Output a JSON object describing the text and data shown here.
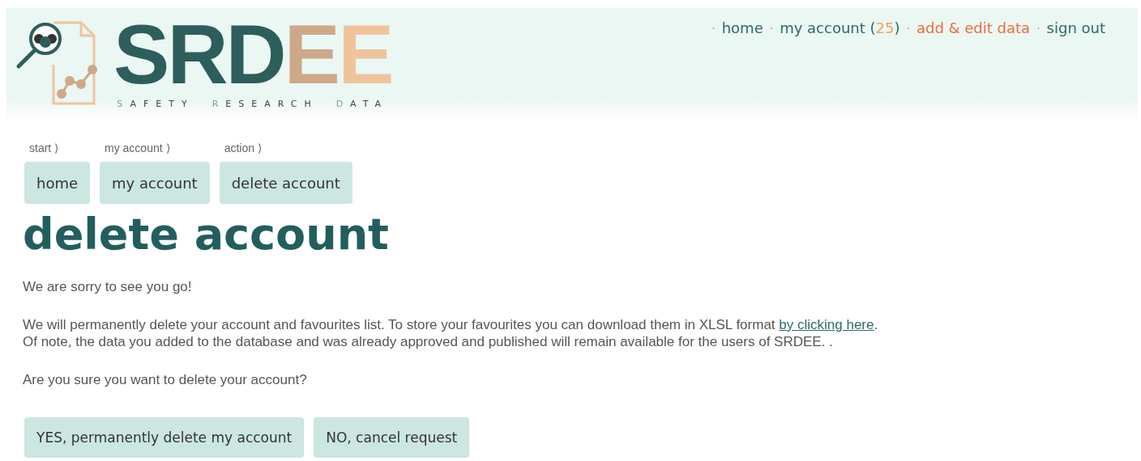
{
  "logo": {
    "letters": [
      {
        "text": "S",
        "color": "#2e5e5c"
      },
      {
        "text": "R",
        "color": "#2e5e5c"
      },
      {
        "text": "D",
        "color": "#2e5e5c"
      },
      {
        "text": "E",
        "color": "#cfa889"
      },
      {
        "text": "E",
        "color": "#efc49d"
      }
    ],
    "tagline": [
      "SAFETY",
      "RESEARCH",
      "DATA"
    ]
  },
  "nav": [
    {
      "separator": "·",
      "label": "home",
      "highlighted": false
    },
    {
      "separator": "·",
      "label": "my account (",
      "count": "25",
      "suffix": ")",
      "highlighted": false
    },
    {
      "separator": "·",
      "label": "add & edit data",
      "highlighted": true
    },
    {
      "separator": "·",
      "label": "sign out",
      "highlighted": false
    }
  ],
  "breadcrumb": [
    {
      "step": "start ⟩",
      "label": "home"
    },
    {
      "step": "my account ⟩",
      "label": "my account"
    },
    {
      "step": "action ⟩",
      "label": "delete account"
    }
  ],
  "title": "delete account",
  "intro": "We are sorry to see you go!",
  "notice": {
    "text": "We will permanently delete your account and favourites list. To store your favourites you can download them in XLSL format ",
    "link": "by clicking here",
    "after": ".",
    "note": "Of note, the data you added to the database and was already approved and published will remain available for the users of SRDEE. ."
  },
  "question": "Are you sure you want to delete your account?",
  "actions": [
    "YES, permanently delete my account",
    "NO, cancel request"
  ]
}
